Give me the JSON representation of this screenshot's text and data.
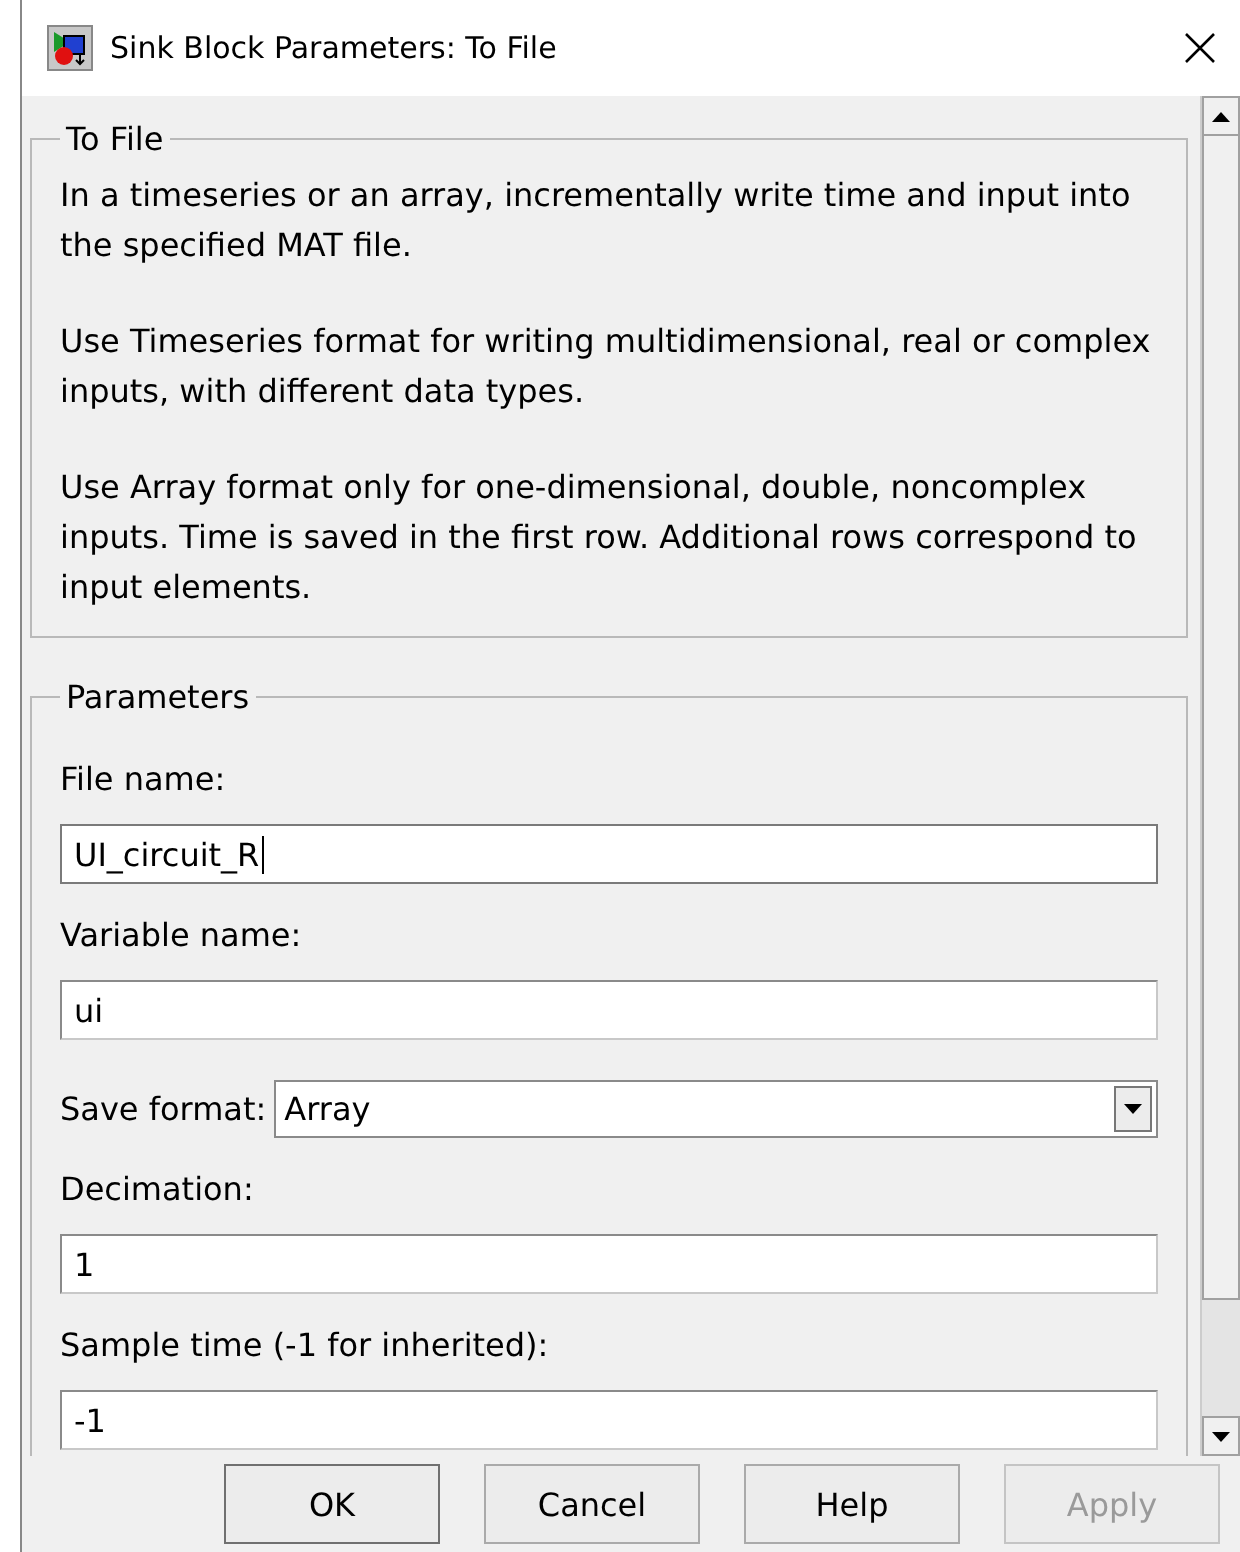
{
  "window": {
    "title": "Sink Block Parameters: To File"
  },
  "description": {
    "title": "To File",
    "paragraphs": [
      "In a timeseries or an array, incrementally write time and input into the specified MAT file.",
      "Use Timeseries format for writing multidimensional, real or complex inputs, with different data types.",
      "Use Array format only for one-dimensional, double, noncomplex inputs. Time is saved in the first row.  Additional rows correspond to input elements."
    ]
  },
  "parameters": {
    "title": "Parameters",
    "fields": [
      {
        "kind": "text",
        "label": "File name:",
        "value": "UI_circuit_R",
        "focused": true
      },
      {
        "kind": "text",
        "label": "Variable name:",
        "value": "ui",
        "focused": false
      },
      {
        "kind": "dropdown",
        "label": "Save format:",
        "value": "Array",
        "focused": false
      },
      {
        "kind": "text",
        "label": "Decimation:",
        "value": "1",
        "focused": false
      },
      {
        "kind": "text",
        "label": "Sample time (-1 for inherited):",
        "value": "-1",
        "focused": false
      }
    ]
  },
  "buttons": [
    {
      "label": "OK",
      "disabled": false
    },
    {
      "label": "Cancel",
      "disabled": false
    },
    {
      "label": "Help",
      "disabled": false
    },
    {
      "label": "Apply",
      "disabled": true
    }
  ]
}
